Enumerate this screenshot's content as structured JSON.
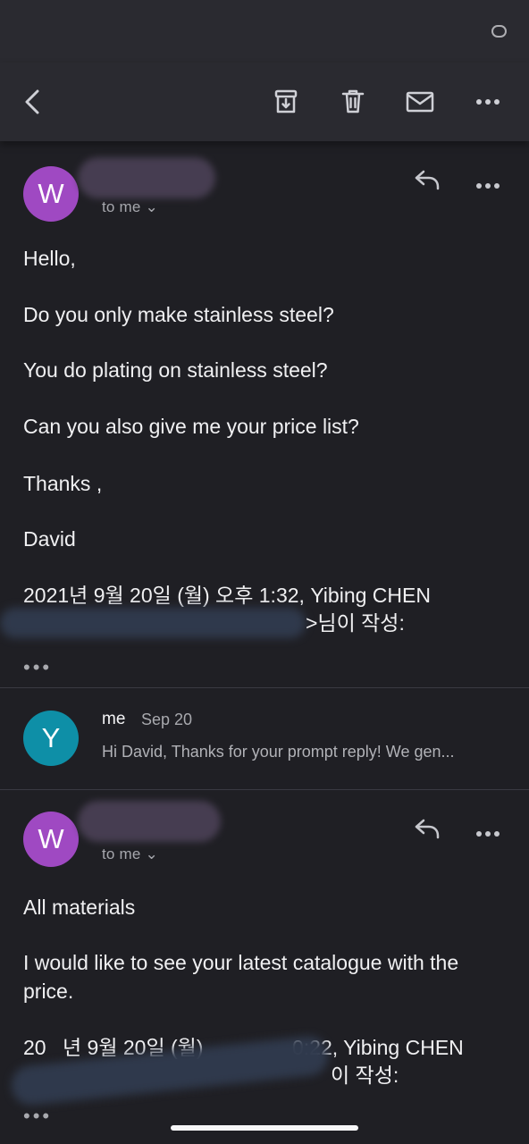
{
  "toolbar": {
    "back_icon": "back-arrow-icon",
    "archive_icon": "archive-icon",
    "delete_icon": "trash-icon",
    "mail_icon": "mail-icon",
    "more_icon": "more-horizontal-icon"
  },
  "messages": [
    {
      "avatar": "W",
      "recipient": "to me",
      "body": [
        "Hello,",
        "Do you only make stainless steel?",
        "You do plating on stainless steel?",
        "Can you also give me your price list?",
        "Thanks ,",
        "David",
        "2021년 9월 20일 (월) 오후 1:32, Yibing CHEN",
        ">님이 작성:"
      ]
    },
    {
      "avatar": "Y",
      "sender": "me",
      "date": "Sep 20",
      "snippet": "Hi David, Thanks for your prompt reply! We gen..."
    },
    {
      "avatar": "W",
      "recipient": "to me",
      "body": [
        "All materials",
        "I would like to see your latest catalogue with the price.",
        "20",
        "년 9월 20일 (월)",
        "0:22, Yibing CHEN",
        "이 작성:"
      ]
    }
  ],
  "expand_dots": "•••"
}
